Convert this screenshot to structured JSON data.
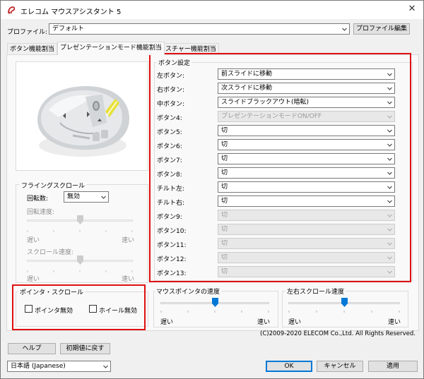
{
  "window": {
    "title": "エレコム マウスアシスタント 5",
    "close_glyph": "✕"
  },
  "profile": {
    "label": "プロファイル:",
    "value": "デフォルト",
    "edit_button": "プロファイル編集"
  },
  "tabs": [
    "ボタン機能割当",
    "プレゼンテーションモード機能割当",
    "ジェスチャー機能割当"
  ],
  "button_settings": {
    "title": "ボタン設定",
    "rows": [
      {
        "label": "左ボタン:",
        "value": "前スライドに移動",
        "enabled": true
      },
      {
        "label": "右ボタン:",
        "value": "次スライドに移動",
        "enabled": true
      },
      {
        "label": "中ボタン:",
        "value": "スライドブラックアウト(暗転)",
        "enabled": true
      },
      {
        "label": "ボタン4:",
        "value": "プレゼンテーションモードON/OFF",
        "enabled": false
      },
      {
        "label": "ボタン5:",
        "value": "切",
        "enabled": true
      },
      {
        "label": "ボタン6:",
        "value": "切",
        "enabled": true
      },
      {
        "label": "ボタン7:",
        "value": "切",
        "enabled": true
      },
      {
        "label": "ボタン8:",
        "value": "切",
        "enabled": true
      },
      {
        "label": "チルト左:",
        "value": "切",
        "enabled": true
      },
      {
        "label": "チルト右:",
        "value": "切",
        "enabled": true
      },
      {
        "label": "ボタン9:",
        "value": "切",
        "enabled": false
      },
      {
        "label": "ボタン10:",
        "value": "切",
        "enabled": false
      },
      {
        "label": "ボタン11:",
        "value": "切",
        "enabled": false
      },
      {
        "label": "ボタン12:",
        "value": "切",
        "enabled": false
      },
      {
        "label": "ボタン13:",
        "value": "切",
        "enabled": false
      }
    ]
  },
  "flying_scroll": {
    "title": "フライングスクロール",
    "rotation_count_label": "回転数:",
    "rotation_count_value": "無効",
    "rotation_speed_label": "回転速度:",
    "scroll_speed_label": "スクロール速度:",
    "slow": "遅い",
    "fast": "速い",
    "rotation_speed_level": 0.5,
    "scroll_speed_level": 0.5
  },
  "pointer_scroll": {
    "title": "ポインタ・スクロール",
    "pointer_disable": "ポインタ無効",
    "wheel_disable": "ホイール無効",
    "pointer_disable_checked": false,
    "wheel_disable_checked": false
  },
  "pointer_speed": {
    "title": "マウスポインタの速度",
    "slow": "遅い",
    "fast": "速い",
    "level": 0.5
  },
  "hscroll_speed": {
    "title": "左右スクロール速度",
    "slow": "遅い",
    "fast": "速い",
    "level": 0.5
  },
  "copyright": "(C)2009-2020 ELECOM Co.,Ltd. All Rights Reserved.",
  "footer": {
    "help": "ヘルプ",
    "reset": "初期値に戻す",
    "language": "日本語 (Japanese)",
    "ok": "OK",
    "cancel": "キャンセル",
    "apply": "適用"
  }
}
